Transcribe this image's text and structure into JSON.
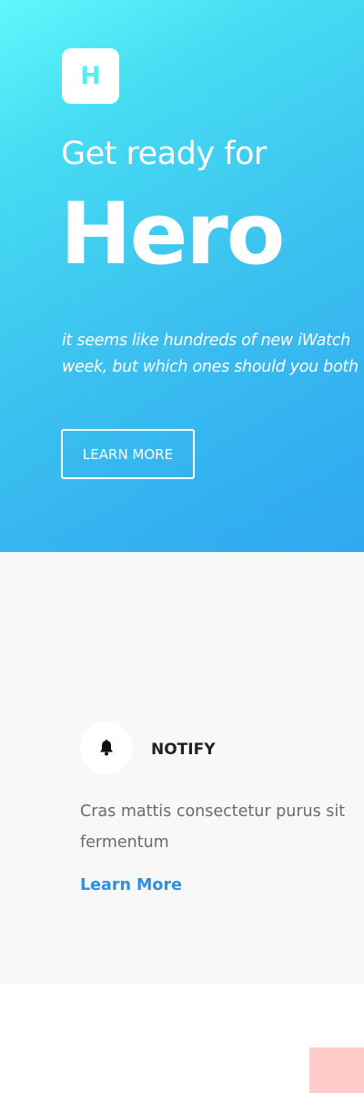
{
  "hero": {
    "logo_letter": "H",
    "eyebrow": "Get ready for",
    "headline": "Hero",
    "tagline_line1": "it seems like hundreds of new iWatch",
    "tagline_line2": "week, but which ones should you both",
    "cta_label": "LEARN MORE",
    "gradient_start": "#5ff9fb",
    "gradient_end": "#31a8f0"
  },
  "feature": {
    "icon": "bell-icon",
    "title": "NOTIFY",
    "description": "Cras mattis consectetur purus sit fermentum",
    "link_label": "Learn More",
    "link_color": "#2f8fe0"
  }
}
